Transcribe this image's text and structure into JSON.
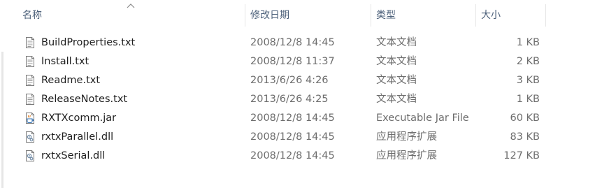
{
  "columns": {
    "name": "名称",
    "modified": "修改日期",
    "type": "类型",
    "size": "大小"
  },
  "files": [
    {
      "name": "BuildProperties.txt",
      "modified": "2008/12/8 14:45",
      "type": "文本文档",
      "size": "1 KB",
      "icon": "text-file-icon"
    },
    {
      "name": "Install.txt",
      "modified": "2008/12/8 11:37",
      "type": "文本文档",
      "size": "2 KB",
      "icon": "text-file-icon"
    },
    {
      "name": "Readme.txt",
      "modified": "2013/6/26 4:26",
      "type": "文本文档",
      "size": "3 KB",
      "icon": "text-file-icon"
    },
    {
      "name": "ReleaseNotes.txt",
      "modified": "2013/6/26 4:25",
      "type": "文本文档",
      "size": "1 KB",
      "icon": "text-file-icon"
    },
    {
      "name": "RXTXcomm.jar",
      "modified": "2008/12/8 14:45",
      "type": "Executable Jar File",
      "size": "60 KB",
      "icon": "jar-file-icon"
    },
    {
      "name": "rxtxParallel.dll",
      "modified": "2008/12/8 14:45",
      "type": "应用程序扩展",
      "size": "83 KB",
      "icon": "dll-file-icon"
    },
    {
      "name": "rxtxSerial.dll",
      "modified": "2008/12/8 14:45",
      "type": "应用程序扩展",
      "size": "127 KB",
      "icon": "dll-file-icon"
    }
  ]
}
